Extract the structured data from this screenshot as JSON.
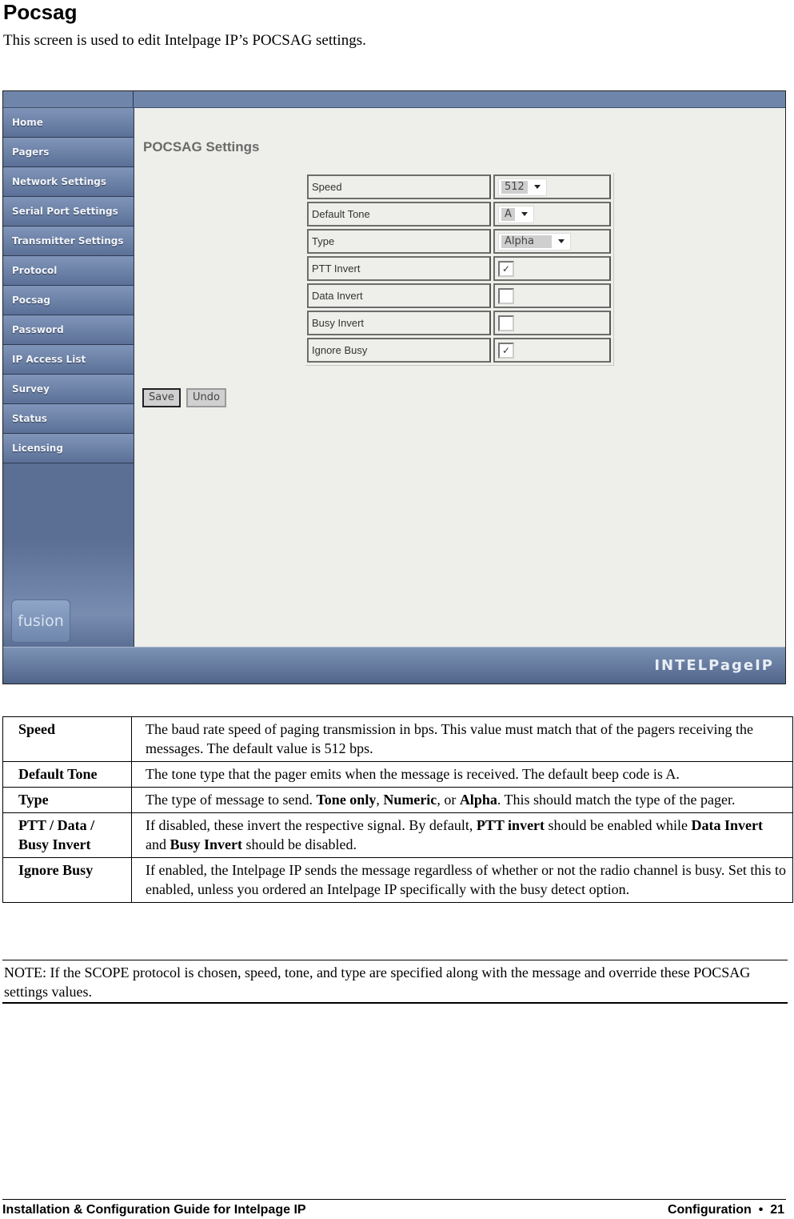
{
  "doc": {
    "heading": "Pocsag",
    "intro": "This screen is used to edit Intelpage IP’s POCSAG settings."
  },
  "screenshot": {
    "sidebar": {
      "items": [
        {
          "label": "Home"
        },
        {
          "label": "Pagers"
        },
        {
          "label": "Network Settings"
        },
        {
          "label": "Serial Port Settings"
        },
        {
          "label": "Transmitter Settings"
        },
        {
          "label": "Protocol"
        },
        {
          "label": "Pocsag"
        },
        {
          "label": "Password"
        },
        {
          "label": "IP Access List"
        },
        {
          "label": "Survey"
        },
        {
          "label": "Status"
        },
        {
          "label": "Licensing"
        }
      ],
      "logo_text": "fusion"
    },
    "page_title": "POCSAG Settings",
    "settings": {
      "speed": {
        "label": "Speed",
        "value": "512"
      },
      "default_tone": {
        "label": "Default Tone",
        "value": "A"
      },
      "type": {
        "label": "Type",
        "value": "Alpha"
      },
      "ptt_invert": {
        "label": "PTT Invert",
        "checked": true,
        "mark": "✓"
      },
      "data_invert": {
        "label": "Data Invert",
        "checked": false,
        "mark": ""
      },
      "busy_invert": {
        "label": "Busy Invert",
        "checked": false,
        "mark": ""
      },
      "ignore_busy": {
        "label": "Ignore Busy",
        "checked": true,
        "mark": "✓"
      }
    },
    "buttons": {
      "save": "Save",
      "undo": "Undo"
    },
    "brand": "INTELPageIP"
  },
  "descriptions": [
    {
      "term": "Speed",
      "text": "The baud rate speed of paging transmission in bps. This value must match that of the pagers receiving the messages. The default value is 512 bps."
    },
    {
      "term": "Default Tone",
      "text": "The tone type that the pager emits when the message is received. The default beep code is A."
    },
    {
      "term": "Type",
      "t1": "The type of message to send. ",
      "b1": "Tone only",
      "t2": ", ",
      "b2": "Numeric",
      "t3": ", or ",
      "b3": "Alpha",
      "t4": ". This should match the type of the pager."
    },
    {
      "term": "PTT / Data / Busy Invert",
      "t1": "If disabled, these invert the respective signal. By default, ",
      "b1": "PTT invert",
      "t2": " should be enabled while ",
      "b2": "Data Invert",
      "t3": " and ",
      "b3": "Busy Invert",
      "t4": " should be disabled."
    },
    {
      "term": "Ignore Busy",
      "text": "If enabled, the Intelpage IP sends the message regardless of whether or not the radio channel is busy. Set this to enabled, unless you ordered an Intelpage IP specifically with the busy detect option."
    }
  ],
  "note": "NOTE: If the SCOPE protocol is chosen, speed, tone, and type are specified along with the message and override these POCSAG settings values.",
  "footer": {
    "left": "Installation & Configuration Guide for Intelpage IP",
    "section": "Configuration",
    "bullet": "•",
    "page": "21"
  }
}
